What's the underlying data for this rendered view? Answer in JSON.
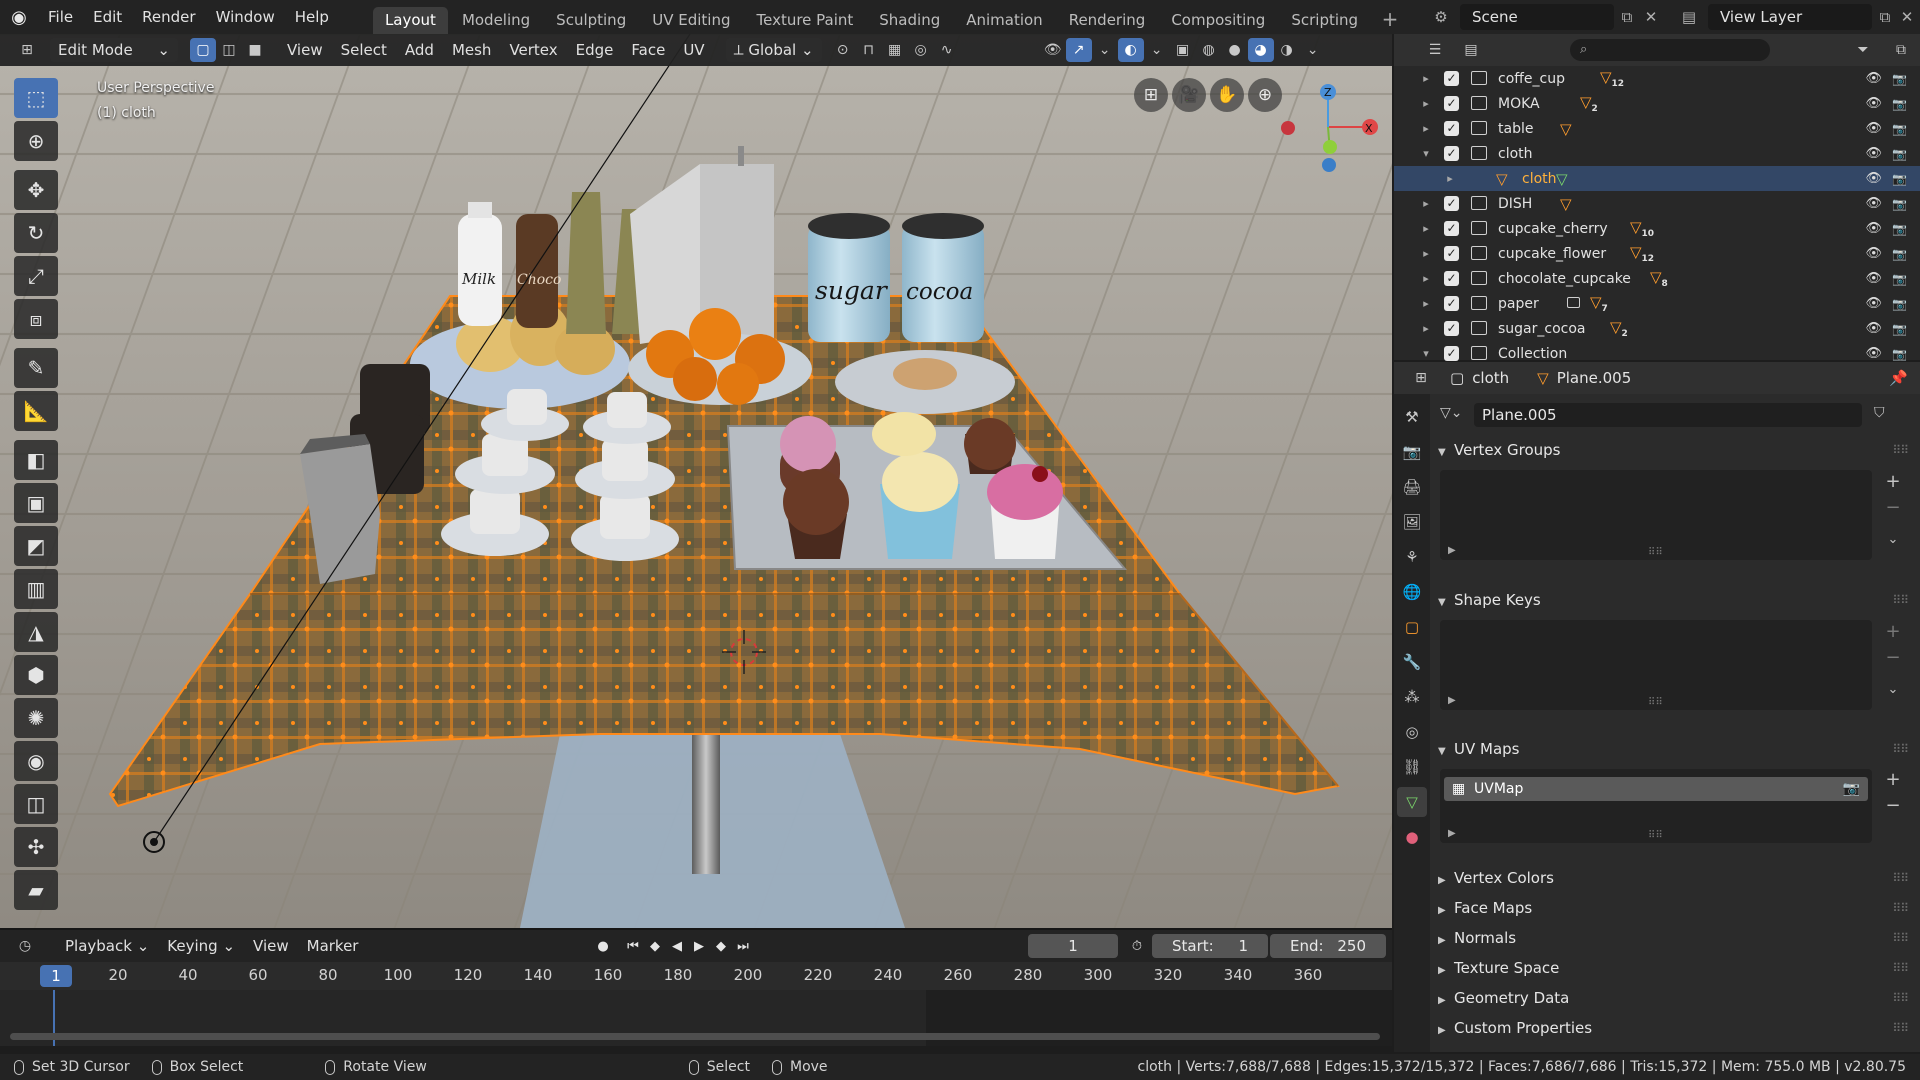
{
  "topbar": {
    "menus": [
      "File",
      "Edit",
      "Render",
      "Window",
      "Help"
    ],
    "workspaces": [
      "Layout",
      "Modeling",
      "Sculpting",
      "UV Editing",
      "Texture Paint",
      "Shading",
      "Animation",
      "Rendering",
      "Compositing",
      "Scripting"
    ],
    "active_workspace": "Layout",
    "scene": "Scene",
    "view_layer": "View Layer"
  },
  "viewport": {
    "mode": "Edit Mode",
    "menus": [
      "View",
      "Select",
      "Add",
      "Mesh",
      "Vertex",
      "Edge",
      "Face",
      "UV"
    ],
    "orientation": "Global",
    "info_line1": "User Perspective",
    "info_line2": "(1) cloth",
    "gizmo_axes": [
      "X",
      "Z"
    ],
    "scene_labels": {
      "milk": "Milk",
      "choco": "Choco",
      "sugar": "sugar",
      "cocoa": "cocoa"
    }
  },
  "timeline": {
    "menus": [
      "Playback",
      "Keying",
      "View",
      "Marker"
    ],
    "current_frame": "1",
    "start_label": "Start:",
    "start": "1",
    "end_label": "End:",
    "end": "250",
    "ruler_ticks": [
      "20",
      "40",
      "60",
      "80",
      "100",
      "120",
      "140",
      "160",
      "180",
      "200",
      "220",
      "240",
      "260",
      "280",
      "300",
      "320",
      "340",
      "360"
    ],
    "marker_frame": "1"
  },
  "statusbar": {
    "hints": [
      "Set 3D Cursor",
      "Box Select",
      "Rotate View",
      "Select",
      "Move"
    ],
    "stats": "cloth | Verts:7,688/7,688 | Edges:15,372/15,372 | Faces:7,686/7,686 | Tris:15,372 | Mem: 755.0 MB | v2.80.75"
  },
  "outliner": {
    "rows": [
      {
        "name": "coffe_cup",
        "count": "12"
      },
      {
        "name": "MOKA",
        "count": "2"
      },
      {
        "name": "table",
        "count": ""
      },
      {
        "name": "cloth",
        "count": ""
      },
      {
        "name": "cloth",
        "count": ""
      },
      {
        "name": "DISH",
        "count": ""
      },
      {
        "name": "cupcake_cherry",
        "count": "10"
      },
      {
        "name": "cupcake_flower",
        "count": "12"
      },
      {
        "name": "chocolate_cupcake",
        "count": "8"
      },
      {
        "name": "paper",
        "count": "7"
      },
      {
        "name": "sugar_cocoa",
        "count": "2"
      },
      {
        "name": "Collection",
        "count": ""
      }
    ]
  },
  "properties": {
    "object": "cloth",
    "mesh": "Plane.005",
    "mesh_field": "Plane.005",
    "panels": {
      "vertex_groups": "Vertex Groups",
      "shape_keys": "Shape Keys",
      "uv_maps": "UV Maps",
      "uv_map_item": "UVMap",
      "vertex_colors": "Vertex Colors",
      "face_maps": "Face Maps",
      "normals": "Normals",
      "texture_space": "Texture Space",
      "geometry_data": "Geometry Data",
      "custom_properties": "Custom Properties"
    }
  },
  "colors": {
    "accent": "#4772b3",
    "active_object": "#ffb13b",
    "mesh_icon": "#ff9d2e",
    "data_tab": "#7bd66b"
  }
}
